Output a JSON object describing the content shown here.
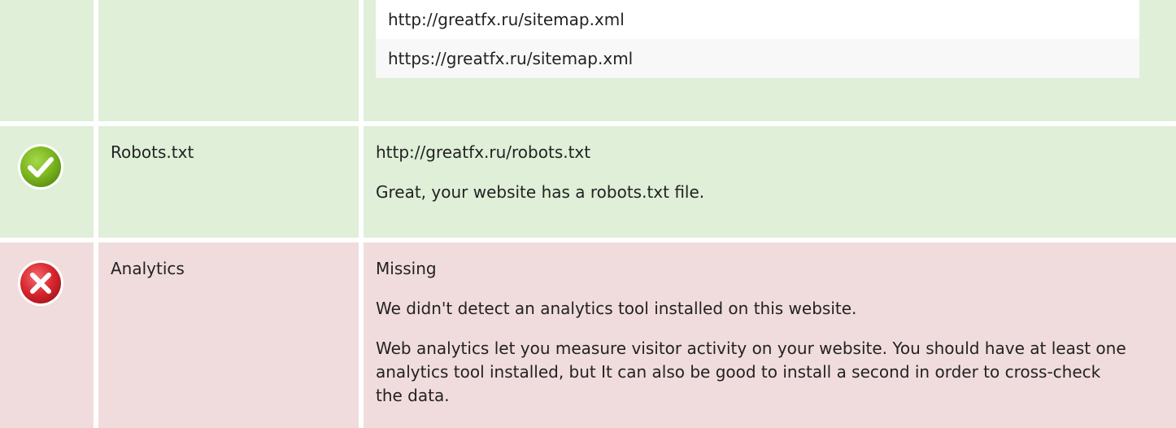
{
  "sitemap": {
    "urls": [
      "http://greatfx.ru/sitemap.xml",
      "https://greatfx.ru/sitemap.xml"
    ]
  },
  "robots": {
    "status": "pass",
    "icon": "check-icon",
    "label": "Robots.txt",
    "value": "http://greatfx.ru/robots.txt",
    "message": "Great, your website has a robots.txt file."
  },
  "analytics": {
    "status": "fail",
    "icon": "cross-icon",
    "label": "Analytics",
    "value": "Missing",
    "message": "We didn't detect an analytics tool installed on this website.",
    "advice": "Web analytics let you measure visitor activity on your website. You should have at least one analytics tool installed, but It can also be good to install a second in order to cross-check the data."
  },
  "colors": {
    "pass_bg": "#dfefd8",
    "fail_bg": "#f1dcdd",
    "pass_icon": "#7bb51f",
    "fail_icon": "#d8252d"
  }
}
